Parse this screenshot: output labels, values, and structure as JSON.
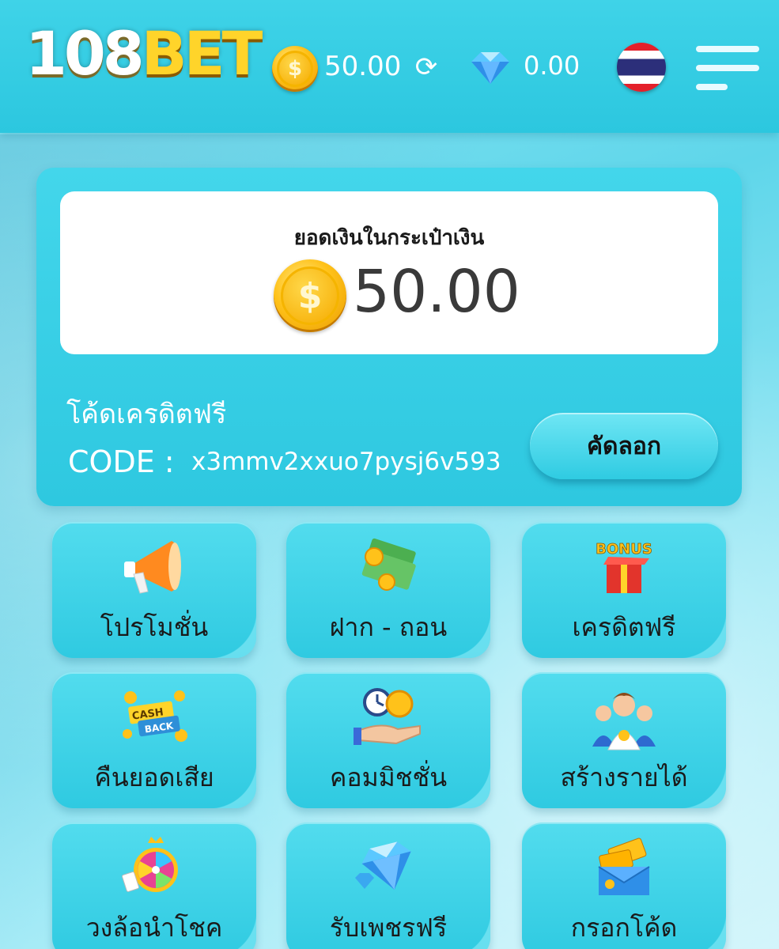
{
  "header": {
    "logo_number": "108",
    "logo_word": "BET",
    "coin_symbol": "$",
    "balance": "50.00",
    "refresh_glyph": "⟳",
    "gem_balance": "0.00",
    "icons": [
      "coin-icon",
      "refresh-icon",
      "diamond-icon",
      "thai-flag-icon",
      "hamburger-menu-icon"
    ]
  },
  "wallet": {
    "title": "ยอดเงินในกระเป๋าเงิน",
    "coin_symbol": "$",
    "amount": "50.00",
    "free_credit_label": "โค้ดเครดิตฟรี",
    "code_label": "CODE :",
    "code_value": "x3mmv2xxuo7pysj6v593",
    "copy_label": "คัดลอก"
  },
  "menu": [
    {
      "label": "โปรโมชั่น",
      "icon": "megaphone-icon"
    },
    {
      "label": "ฝาก - ถอน",
      "icon": "money-stack-icon"
    },
    {
      "label": "เครดิตฟรี",
      "icon": "bonus-gift-icon"
    },
    {
      "label": "คืนยอดเสีย",
      "icon": "cashback-icon"
    },
    {
      "label": "คอมมิชชั่น",
      "icon": "commission-icon"
    },
    {
      "label": "สร้างรายได้",
      "icon": "team-icon"
    },
    {
      "label": "วงล้อนำโชค",
      "icon": "lucky-wheel-icon"
    },
    {
      "label": "รับเพชรฟรี",
      "icon": "diamond-icon"
    },
    {
      "label": "กรอกโค้ด",
      "icon": "coupon-icon"
    }
  ],
  "badges": {
    "bonus_text": "BONUS",
    "cash_text": "CASH",
    "back_text": "BACK"
  },
  "colors": {
    "accent": "#2ec8e0",
    "coin": "#ffc21a",
    "logo_yellow": "#ffd42a"
  }
}
